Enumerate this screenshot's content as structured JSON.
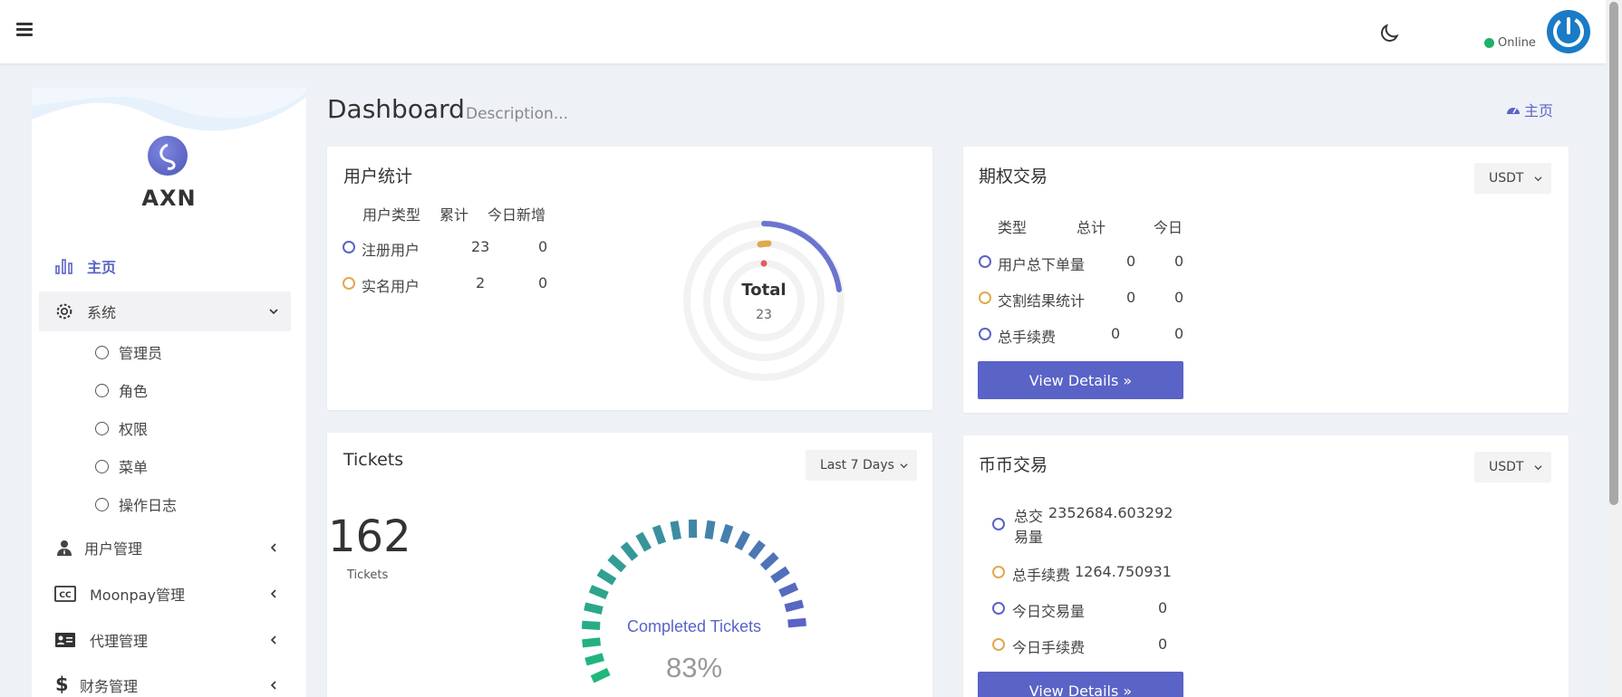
{
  "topbar": {
    "status": "Online"
  },
  "sidebar": {
    "brand": "AXN",
    "items": [
      {
        "label": "主页"
      },
      {
        "label": "系统"
      },
      {
        "label": "用户管理"
      },
      {
        "label": "Moonpay管理"
      },
      {
        "label": "代理管理"
      },
      {
        "label": "财务管理"
      }
    ],
    "sub_items": [
      "管理员",
      "角色",
      "权限",
      "菜单",
      "操作日志"
    ]
  },
  "header": {
    "title": "Dashboard",
    "description": "Description...",
    "breadcrumb": "主页"
  },
  "user_stats": {
    "title": "用户统计",
    "columns": [
      "用户类型",
      "累计",
      "今日新增"
    ],
    "rows": [
      {
        "type": "注册用户",
        "total": "23",
        "today": "0"
      },
      {
        "type": "实名用户",
        "total": "2",
        "today": "0"
      }
    ],
    "donut": {
      "label": "Total",
      "value": "23"
    }
  },
  "options": {
    "title": "期权交易",
    "currency": "USDT",
    "columns": [
      "类型",
      "总计",
      "今日"
    ],
    "rows": [
      {
        "type": "用户总下单量",
        "total": "0",
        "today": "0"
      },
      {
        "type": "交割结果统计",
        "total": "0",
        "today": "0"
      },
      {
        "type": "总手续费",
        "total": "0",
        "today": "0"
      }
    ],
    "button": "View Details »"
  },
  "tickets": {
    "title": "Tickets",
    "range": "Last 7 Days",
    "count": "162",
    "count_label": "Tickets",
    "gauge_label": "Completed Tickets",
    "gauge_value": "83%"
  },
  "coin": {
    "title": "币币交易",
    "currency": "USDT",
    "rows": [
      {
        "label_a": "总交",
        "label_b": "易量",
        "value": "2352684.603292"
      },
      {
        "label": "总手续费",
        "value": "1264.750931"
      },
      {
        "label": "今日交易量",
        "value": "0"
      },
      {
        "label": "今日手续费",
        "value": "0"
      }
    ],
    "button": "View Details »"
  },
  "colors": {
    "accent": "#5a63c6",
    "orange": "#e1a84c",
    "online": "#1fb06a"
  }
}
